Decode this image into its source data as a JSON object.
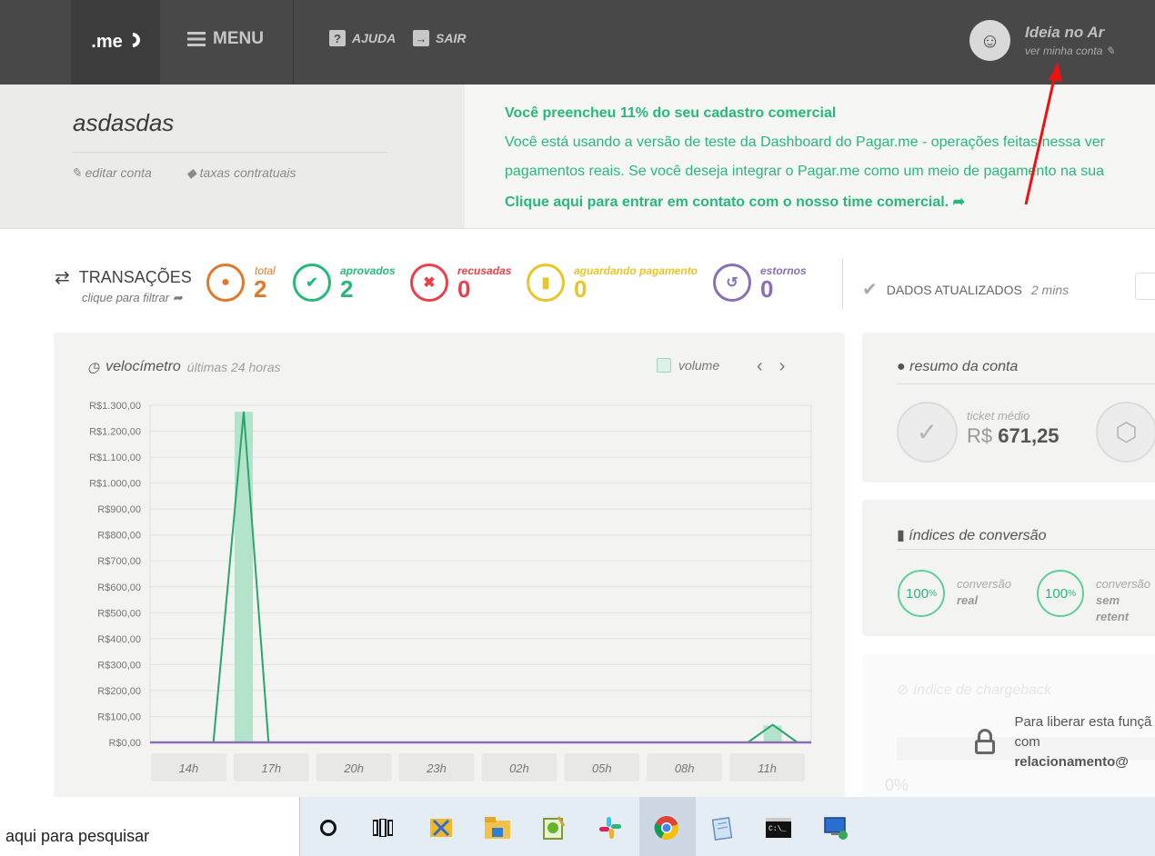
{
  "header": {
    "logo_text": ".me",
    "menu_label": "MENU",
    "help_label": "AJUDA",
    "logout_label": "SAIR",
    "user_name": "Ideia no Ar",
    "user_sub": "ver minha conta"
  },
  "account": {
    "name": "asdasdas",
    "edit_link": "editar conta",
    "fees_link": "taxas contratuais"
  },
  "banner": {
    "line1": "Você preencheu 11% do seu cadastro comercial",
    "line2": "Você está usando a versão de teste da Dashboard do Pagar.me - operações feitas nessa ver",
    "line3": "pagamentos reais. Se você deseja integrar o Pagar.me como um meio de pagamento na sua",
    "line4": "Clique aqui para entrar em contato com o nosso time comercial."
  },
  "transactions": {
    "title": "TRANSAÇÕES",
    "subtitle": "clique para filtrar",
    "stats": [
      {
        "label": "total",
        "value": "2",
        "color": "#e07a2a"
      },
      {
        "label": "aprovados",
        "value": "2",
        "color": "#27b97a"
      },
      {
        "label": "recusadas",
        "value": "0",
        "color": "#e8414d"
      },
      {
        "label": "aguardando pagamento",
        "value": "0",
        "color": "#e8c52a"
      },
      {
        "label": "estornos",
        "value": "0",
        "color": "#8a6fb5"
      }
    ],
    "updated_label": "DADOS ATUALIZADOS",
    "updated_time": "2 mins"
  },
  "speedometer": {
    "title": "velocímetro",
    "period": "últimas 24 horas",
    "volume_label": "volume"
  },
  "chart_data": {
    "type": "bar",
    "yticks": [
      "R$1.300,00",
      "R$1.200,00",
      "R$1.100,00",
      "R$1.000,00",
      "R$900,00",
      "R$800,00",
      "R$700,00",
      "R$600,00",
      "R$500,00",
      "R$400,00",
      "R$300,00",
      "R$200,00",
      "R$100,00",
      "R$0,00"
    ],
    "ylim": [
      0,
      1300
    ],
    "xticks": [
      "14h",
      "17h",
      "20h",
      "23h",
      "02h",
      "05h",
      "08h",
      "11h"
    ],
    "xlim": [
      0,
      24
    ],
    "bars": [
      {
        "x": 3.4,
        "value": 1275
      },
      {
        "x": 22.6,
        "value": 65
      }
    ],
    "line": [
      {
        "x": 2.3,
        "y": 0
      },
      {
        "x": 3.4,
        "y": 1275
      },
      {
        "x": 4.3,
        "y": 0
      },
      {
        "x": 21.7,
        "y": 0
      },
      {
        "x": 22.6,
        "y": 68
      },
      {
        "x": 23.5,
        "y": 0
      }
    ],
    "colors": {
      "bar": "#b3e3cb",
      "line": "#2aa56c",
      "baseline": "#8a6fb5"
    }
  },
  "summary": {
    "title": "resumo da conta",
    "ticket_label": "ticket médio",
    "currency": "R$",
    "ticket_value": "671,25"
  },
  "conversion": {
    "title": "índices de conversão",
    "items": [
      {
        "value": "100",
        "unit": "%",
        "label": "conversão",
        "sub": "real"
      },
      {
        "value": "100",
        "unit": "%",
        "label": "conversão",
        "sub": "sem retent"
      }
    ]
  },
  "chargeback": {
    "title": "índice de chargeback",
    "value": "0%",
    "lock_line1": "Para liberar esta funçã",
    "lock_line2_prefix": "com ",
    "lock_line2_bold": "relacionamento@"
  },
  "taskbar": {
    "search_placeholder": "aqui para pesquisar"
  }
}
